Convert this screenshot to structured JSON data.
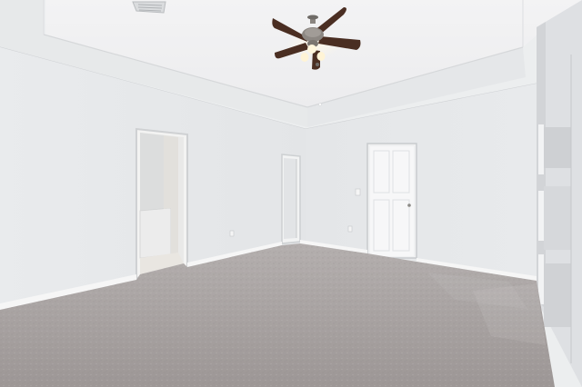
{
  "scene": {
    "subject": "empty-bedroom-interior",
    "elements": [
      "tray-ceiling",
      "ceiling-fan-with-light-kit",
      "hvac-vent",
      "carpet-floor",
      "open-doorway-to-bathroom",
      "open-doorway-hallway",
      "closed-panel-door",
      "side-passage-columns",
      "light-switch",
      "wall-outlets"
    ]
  },
  "colors": {
    "ceiling": "#f4f4f5",
    "tray_fascia": "#e9ebec",
    "back_wall": "#e6e8ea",
    "left_wall": "#eaecee",
    "right_wall": "#dfe1e4",
    "carpet": "#a8a2a1",
    "door": "#f7f7f8",
    "fan_blade": "#4a2e22",
    "fan_metal": "#8a8580",
    "light_glow": "#fff8e6"
  }
}
